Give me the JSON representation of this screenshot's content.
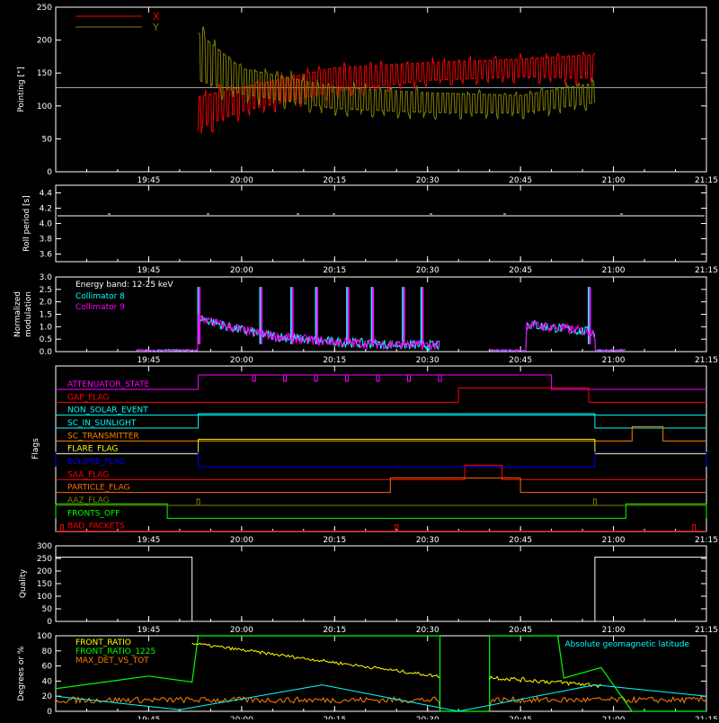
{
  "time_axis": {
    "start": "19:30",
    "end": "21:15",
    "tick_labels": [
      "19:45",
      "20:00",
      "20:15",
      "20:30",
      "20:45",
      "21:00",
      "21:15"
    ],
    "tick_minutes_from_start": [
      15,
      30,
      45,
      60,
      75,
      90,
      105
    ]
  },
  "chart_data": [
    {
      "type": "line",
      "ylabel": "Pointing [\"]",
      "ylim": [
        0,
        250
      ],
      "y_ticks": [
        "0",
        "50",
        "100",
        "150",
        "200",
        "250"
      ],
      "reference_line": 128,
      "legend": [
        {
          "name": "X",
          "color": "#ff0000"
        },
        {
          "name": "Y",
          "color": "#808000"
        }
      ],
      "series": [
        {
          "name": "X",
          "color": "#ff0000",
          "start": "19:53",
          "end": "20:57",
          "envelope_points": [
            {
              "t": "19:53",
              "lo": 50,
              "hi": 130
            },
            {
              "t": "20:00",
              "lo": 80,
              "hi": 140
            },
            {
              "t": "20:15",
              "lo": 110,
              "hi": 170
            },
            {
              "t": "20:30",
              "lo": 130,
              "hi": 175
            },
            {
              "t": "20:45",
              "lo": 135,
              "hi": 180
            },
            {
              "t": "20:57",
              "lo": 130,
              "hi": 190
            }
          ]
        },
        {
          "name": "Y",
          "color": "#808000",
          "start": "19:53",
          "end": "20:57",
          "envelope_points": [
            {
              "t": "19:53",
              "lo": 115,
              "hi": 235
            },
            {
              "t": "20:00",
              "lo": 105,
              "hi": 170
            },
            {
              "t": "20:15",
              "lo": 85,
              "hi": 140
            },
            {
              "t": "20:30",
              "lo": 80,
              "hi": 130
            },
            {
              "t": "20:45",
              "lo": 80,
              "hi": 125
            },
            {
              "t": "20:57",
              "lo": 95,
              "hi": 145
            }
          ]
        }
      ]
    },
    {
      "type": "line",
      "ylabel": "Roll period [s]",
      "ylim": [
        3.5,
        4.5
      ],
      "y_ticks": [
        "3.6",
        "3.8",
        "4.0",
        "4.2",
        "4.4"
      ],
      "series": [
        {
          "name": "",
          "color": "#ffffff",
          "value": 4.1
        }
      ]
    },
    {
      "type": "line",
      "ylabel": "Normalized modulation",
      "ylim": [
        0,
        3
      ],
      "y_ticks": [
        "0.0",
        "0.5",
        "1.0",
        "1.5",
        "2.0",
        "2.5",
        "3.0"
      ],
      "annotation": "Energy band: 12-25 keV",
      "legend": [
        {
          "name": "Collimator 8",
          "color": "#00ffff"
        },
        {
          "name": "Collimator 9",
          "color": "#ff00ff"
        }
      ],
      "data_segments": [
        {
          "start": "19:43",
          "end": "20:32"
        },
        {
          "start": "20:40",
          "end": "21:02"
        }
      ],
      "spikes": [
        "19:53",
        "20:03",
        "20:08",
        "20:12",
        "20:17",
        "20:21",
        "20:26",
        "20:29",
        "20:56"
      ]
    },
    {
      "type": "line",
      "ylabel": "Flags",
      "flags": [
        {
          "name": "ATTENUATOR_STATE",
          "color": "#ff00ff",
          "high": [
            [
              "19:53",
              "20:50"
            ]
          ],
          "spikes": [
            "20:02",
            "20:07",
            "20:12",
            "20:17",
            "20:22",
            "20:27",
            "20:32"
          ]
        },
        {
          "name": "GAP_FLAG",
          "color": "#ff0000",
          "high": [
            [
              "20:35",
              "20:56"
            ]
          ]
        },
        {
          "name": "NON_SOLAR_EVENT",
          "color": "#00ffff",
          "high": []
        },
        {
          "name": "SC_IN_SUNLIGHT",
          "color": "#00ffff",
          "high": [
            [
              "19:53",
              "20:57"
            ]
          ]
        },
        {
          "name": "SC_TRANSMITTER",
          "color": "#ff8000",
          "high": [
            [
              "21:03",
              "21:08"
            ]
          ]
        },
        {
          "name": "FLARE_FLAG",
          "color": "#ffff00",
          "high": [
            [
              "19:53",
              "20:57"
            ]
          ]
        },
        {
          "name": "ECLIPSE_FLAG",
          "color": "#0000ff",
          "high": [
            [
              "19:30",
              "19:53"
            ],
            [
              "20:57",
              "21:15"
            ]
          ]
        },
        {
          "name": "SAA_FLAG",
          "color": "#ff0000",
          "high": [
            [
              "20:36",
              "20:42"
            ]
          ]
        },
        {
          "name": "PARTICLE_FLAG",
          "color": "#ff6a00",
          "high": [
            [
              "20:24",
              "20:45"
            ]
          ]
        },
        {
          "name": "AAZ_FLAG",
          "color": "#808000",
          "spikes": [
            "19:53",
            "20:57"
          ],
          "high": []
        },
        {
          "name": "FRONTS_OFF",
          "color": "#00ff00",
          "high": [
            [
              "19:30",
              "19:48"
            ],
            [
              "21:02",
              "21:15"
            ]
          ]
        },
        {
          "name": "BAD_PACKETS",
          "color": "#ff0000",
          "spikes": [
            "19:31",
            "20:25",
            "21:13"
          ],
          "high": []
        }
      ]
    },
    {
      "type": "line",
      "ylabel": "Quality",
      "ylim": [
        0,
        300
      ],
      "y_ticks": [
        "0",
        "50",
        "100",
        "150",
        "200",
        "250",
        "300"
      ],
      "series": [
        {
          "name": "",
          "color": "#ffffff",
          "segments": [
            {
              "start": "19:30",
              "end": "19:52",
              "value": 255
            },
            {
              "start": "19:52",
              "end": "20:57",
              "value": 0
            },
            {
              "start": "20:57",
              "end": "21:15",
              "value": 255
            }
          ]
        }
      ]
    },
    {
      "type": "line",
      "ylabel": "Degrees or %",
      "ylim": [
        0,
        100
      ],
      "y_ticks": [
        "0",
        "20",
        "40",
        "60",
        "80",
        "100"
      ],
      "legend": [
        {
          "name": "FRONT_RATIO",
          "color": "#ffff00"
        },
        {
          "name": "FRONT_RATIO_1225",
          "color": "#00ff00"
        },
        {
          "name": "MAX_DET_VS_TOT",
          "color": "#ff8000"
        }
      ],
      "annotation": "Absolute geomagnetic latitude",
      "annotation_color": "#00ffff",
      "series": [
        {
          "name": "Absolute geomagnetic latitude",
          "color": "#00ffff",
          "points": [
            [
              "19:30",
              20
            ],
            [
              "19:50",
              2
            ],
            [
              "20:13",
              35
            ],
            [
              "20:35",
              0
            ],
            [
              "20:57",
              35
            ],
            [
              "21:15",
              20
            ]
          ]
        },
        {
          "name": "MAX_DET_VS_TOT",
          "color": "#ff8000",
          "level": 15
        }
      ]
    }
  ]
}
